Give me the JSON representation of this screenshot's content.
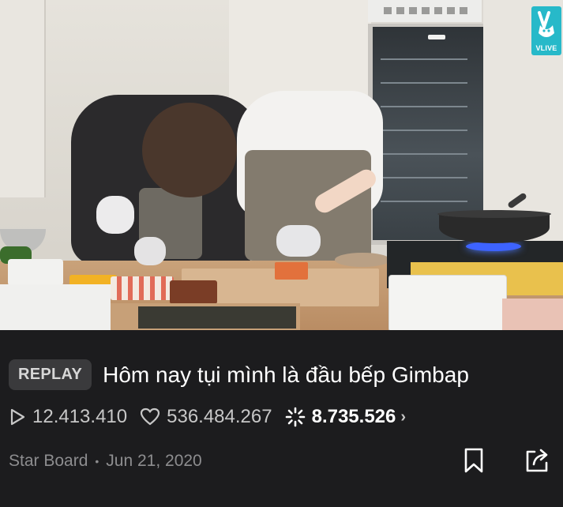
{
  "video": {
    "channel_logo": {
      "icon": "v-peace-hand-icon",
      "text": "VLIVE",
      "color": "#27b9c9"
    }
  },
  "info": {
    "badge": "REPLAY",
    "title": "Hôm nay tụi mình là đầu bếp Gimbap",
    "stats": {
      "plays": {
        "icon": "play-outline-icon",
        "value": "12.413.410"
      },
      "likes": {
        "icon": "heart-outline-icon",
        "value": "536.484.267"
      },
      "hearts": {
        "icon": "sparkle-burst-icon",
        "value": "8.735.526"
      }
    },
    "channel": "Star Board",
    "separator": "•",
    "date": "Jun 21, 2020",
    "actions": [
      {
        "icon": "bookmark-icon"
      },
      {
        "icon": "share-icon"
      }
    ]
  },
  "colors": {
    "background": "#1c1c1e",
    "badge_bg": "#3a3a3c",
    "meta_text": "#8d8d8f"
  }
}
